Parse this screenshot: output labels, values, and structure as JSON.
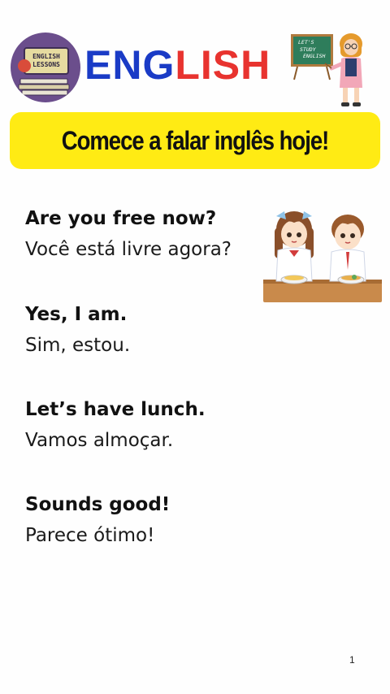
{
  "header": {
    "badge_line1": "ENGLISH",
    "badge_line2": "LESSONS",
    "title_part1": "ENG",
    "title_part2": "LISH",
    "title_colors": {
      "part1": "#1a3bc6",
      "part2": "#e8332f"
    },
    "board_line1": "LET'S",
    "board_line2": "STUDY",
    "board_line3": "ENGLISH"
  },
  "banner": {
    "text": "Comece a falar inglês hoje!",
    "background": "#ffeb14"
  },
  "dialogue": [
    {
      "english": "Are you free now?",
      "portuguese": "Você está livre agora?"
    },
    {
      "english": "Yes, I am.",
      "portuguese": " Sim, estou."
    },
    {
      "english": "Let’s have lunch.",
      "portuguese": "Vamos almoçar."
    },
    {
      "english": "Sounds good!",
      "portuguese": "Parece ótimo!"
    }
  ],
  "illustrations": {
    "badge": "english-lessons-badge",
    "teacher": "teacher-with-chalkboard",
    "kids": "two-students-eating-lunch"
  },
  "footer": {
    "page_number": "1"
  }
}
